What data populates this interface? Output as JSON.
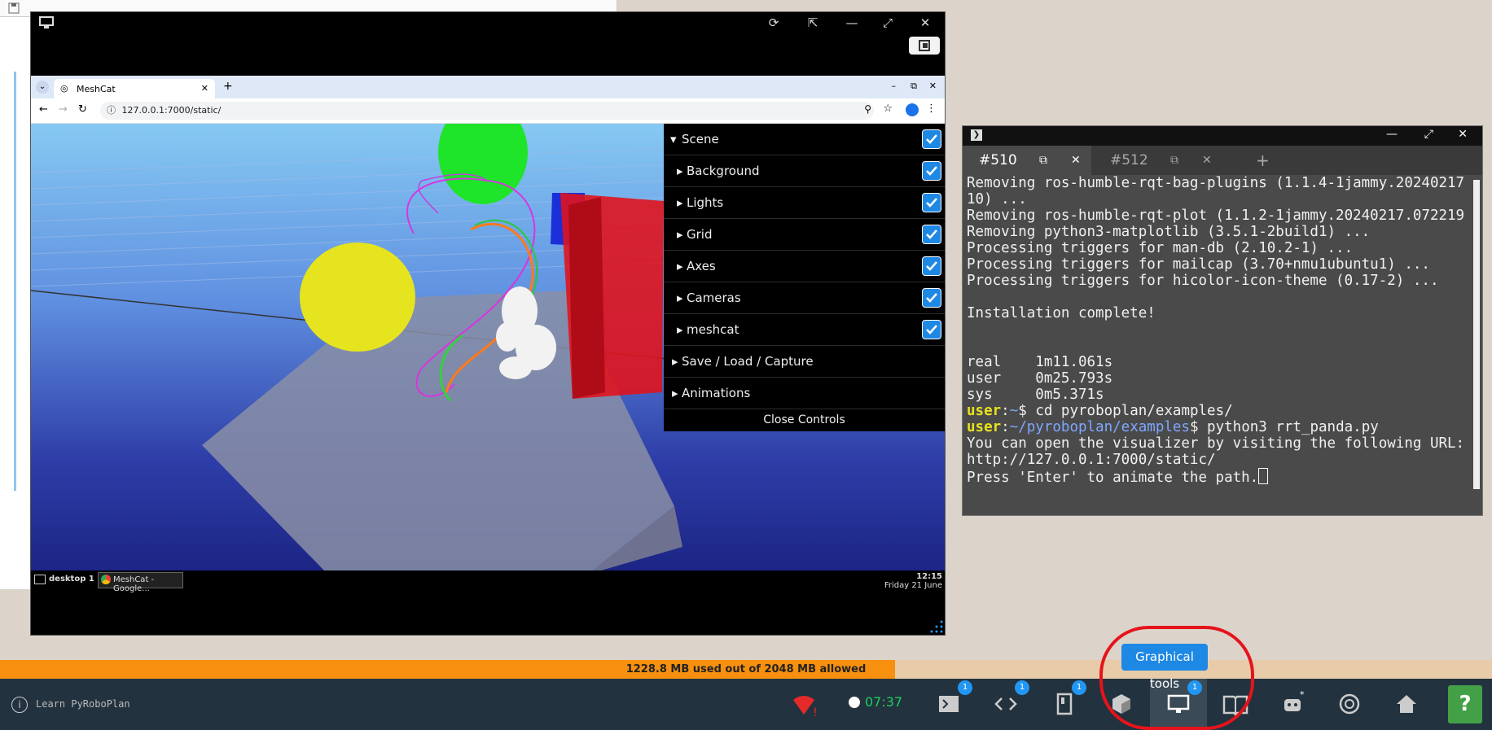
{
  "vnc": {
    "taskbar_desktop": "desktop 1",
    "taskbar_app": "MeshCat - Google...",
    "clock_time": "12:15",
    "clock_date": "Friday 21 June"
  },
  "browser": {
    "tab_title": "MeshCat",
    "url": "127.0.0.1:7000/static/"
  },
  "meshcat": {
    "controls": [
      {
        "label": "Scene",
        "expanded": true,
        "checked": true
      },
      {
        "label": "Background",
        "checked": true
      },
      {
        "label": "Lights",
        "checked": true
      },
      {
        "label": "Grid",
        "checked": true
      },
      {
        "label": "Axes",
        "checked": true
      },
      {
        "label": "Cameras",
        "checked": true
      },
      {
        "label": "meshcat",
        "checked": true
      },
      {
        "label": "Save / Load / Capture"
      },
      {
        "label": "Animations"
      }
    ],
    "close_controls": "Close Controls"
  },
  "terminal": {
    "tabs": [
      "#510",
      "#512"
    ],
    "lines": [
      "Removing ros-humble-rqt-bag-plugins (1.1.4-1jammy.20240217",
      "10) ...",
      "Removing ros-humble-rqt-plot (1.1.2-1jammy.20240217.072219",
      "Removing python3-matplotlib (3.5.1-2build1) ...",
      "Processing triggers for man-db (2.10.2-1) ...",
      "Processing triggers for mailcap (3.70+nmu1ubuntu1) ...",
      "Processing triggers for hicolor-icon-theme (0.17-2) ...",
      "",
      "Installation complete!",
      "",
      "",
      "real    1m11.061s",
      "user    0m25.793s",
      "sys     0m5.371s"
    ],
    "prompt_user": "user",
    "prompt1_path": "~",
    "prompt1_cmd": "cd pyroboplan/examples/",
    "prompt2_path": "~/pyroboplan/examples",
    "prompt2_cmd": "python3 rrt_panda.py",
    "out1": "You can open the visualizer by visiting the following URL:",
    "out2": "http://127.0.0.1:7000/static/",
    "out3": "Press 'Enter' to animate the path."
  },
  "memory": {
    "text": "1228.8 MB used out of 2048 MB allowed",
    "used_fraction": 0.6
  },
  "bottombar": {
    "learn_label": "Learn PyRoboPlan",
    "timer": "07:37",
    "graphical_tools_label": "Graphical tools",
    "badge_value": "1"
  }
}
